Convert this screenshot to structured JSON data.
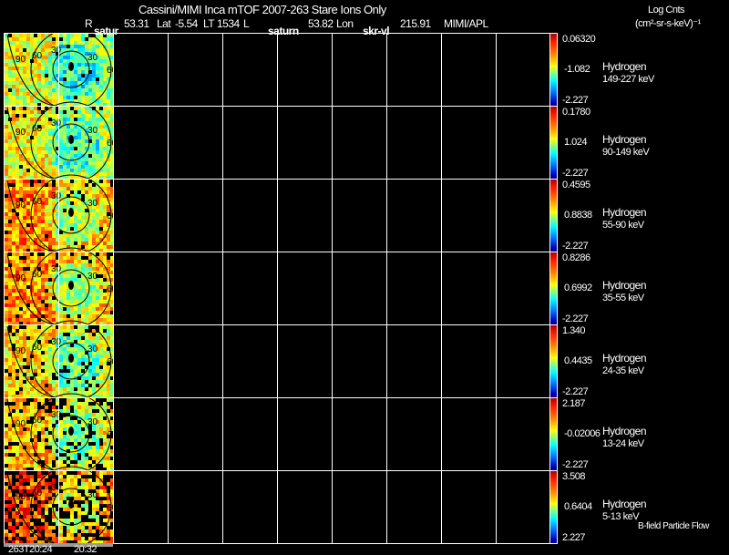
{
  "header": {
    "title": "Cassini/MIMI Inca mTOF  2007-263   Stare   Ions Only",
    "r_label": "R",
    "r_value": "53.31",
    "lat_label": "Lat",
    "lat_value": "-5.54",
    "lt_label": "LT",
    "lt_value": "1534",
    "l_label": "L",
    "l_value": "53.82",
    "lon_label": "Lon",
    "lon_value": "215.91",
    "org": "MIMI/APL",
    "units_line1": "Log Cnts",
    "units_line2": "(cm²-sr-s-keV)⁻¹"
  },
  "overlay_labels": [
    "satur",
    "saturn",
    "skr-vl"
  ],
  "panels": [
    {
      "species": "Hydrogen",
      "energy": "149-227 keV",
      "cb_max": "0.06320",
      "cb_mid": "-1.082",
      "cb_min": "-2.227"
    },
    {
      "species": "Hydrogen",
      "energy": "90-149 keV",
      "cb_max": "0.1780",
      "cb_mid": "1.024",
      "cb_min": "-2.227"
    },
    {
      "species": "Hydrogen",
      "energy": "55-90 keV",
      "cb_max": "0.4595",
      "cb_mid": "0.8838",
      "cb_min": "-2.227"
    },
    {
      "species": "Hydrogen",
      "energy": "35-55 keV",
      "cb_max": "0.8286",
      "cb_mid": "0.6992",
      "cb_min": "-2.227"
    },
    {
      "species": "Hydrogen",
      "energy": "24-35 keV",
      "cb_max": "1.340",
      "cb_mid": "0.4435",
      "cb_min": "-2.227"
    },
    {
      "species": "Hydrogen",
      "energy": "13-24 keV",
      "cb_max": "2.187",
      "cb_mid": "-0.02006",
      "cb_min": "-2.227"
    },
    {
      "species": "Hydrogen",
      "energy": "5-13 keV",
      "cb_max": "3.508",
      "cb_mid": "0.6404",
      "cb_min": "2.227"
    }
  ],
  "contour_labels": [
    "90",
    "60",
    "30",
    "30",
    "60"
  ],
  "time_labels": [
    "263T20:24",
    "20:32"
  ],
  "legend_note": "B-field Particle Flow"
}
